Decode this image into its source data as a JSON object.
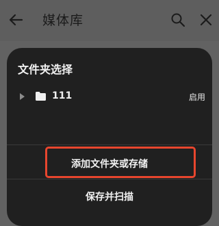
{
  "appbar": {
    "title": "媒体库",
    "back_icon": "arrow-left-icon",
    "search_icon": "search-icon",
    "close_icon": "close-icon"
  },
  "dialog": {
    "title": "文件夹选择",
    "folders": [
      {
        "name": "111",
        "status": "启用",
        "expand_icon": "expand-triangle-icon",
        "folder_icon": "folder-icon"
      }
    ],
    "add_button_label": "添加文件夹或存储",
    "save_button_label": "保存并扫描"
  },
  "colors": {
    "overlay": "#626262",
    "dialog_bg": "#202020",
    "highlight": "#e8462e"
  }
}
